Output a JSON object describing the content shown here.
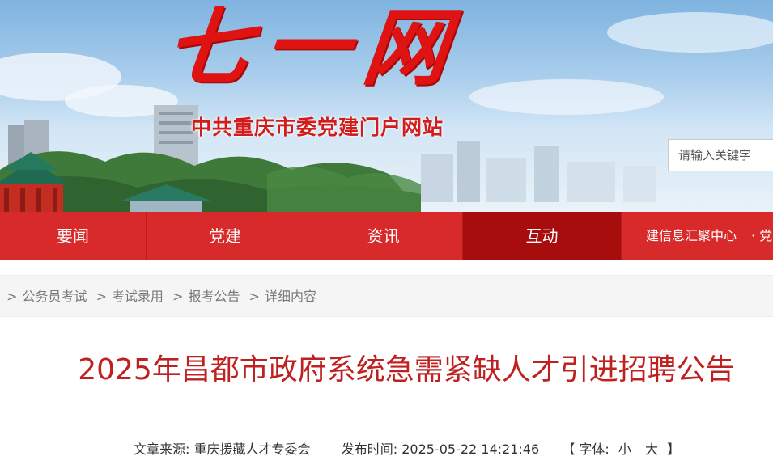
{
  "banner": {
    "logo_title": "七一网",
    "subtitle": "中共重庆市委党建门户网站",
    "search_placeholder": "请输入关键字"
  },
  "nav": {
    "items": [
      {
        "label": "要闻",
        "active": false
      },
      {
        "label": "党建",
        "active": false
      },
      {
        "label": "资讯",
        "active": false
      },
      {
        "label": "互动",
        "active": true
      }
    ],
    "sub_text": "建信息汇聚中心",
    "sub_dot": "· 党",
    "color": "#d82a2a",
    "active_color": "#a70d0d"
  },
  "breadcrumb": {
    "items": [
      "公务员考试",
      "考试录用",
      "报考公告",
      "详细内容"
    ],
    "separator": ">"
  },
  "article": {
    "title": "2025年昌都市政府系统急需紧缺人才引进招聘公告",
    "source_label": "文章来源:",
    "source": "重庆援藏人才专委会",
    "time_label": "发布时间:",
    "time": "2025-05-22 14:21:46",
    "font_open": "【 字体:",
    "font_small": "小",
    "font_large": "大",
    "font_close": "】",
    "title_color": "#bf2020"
  }
}
